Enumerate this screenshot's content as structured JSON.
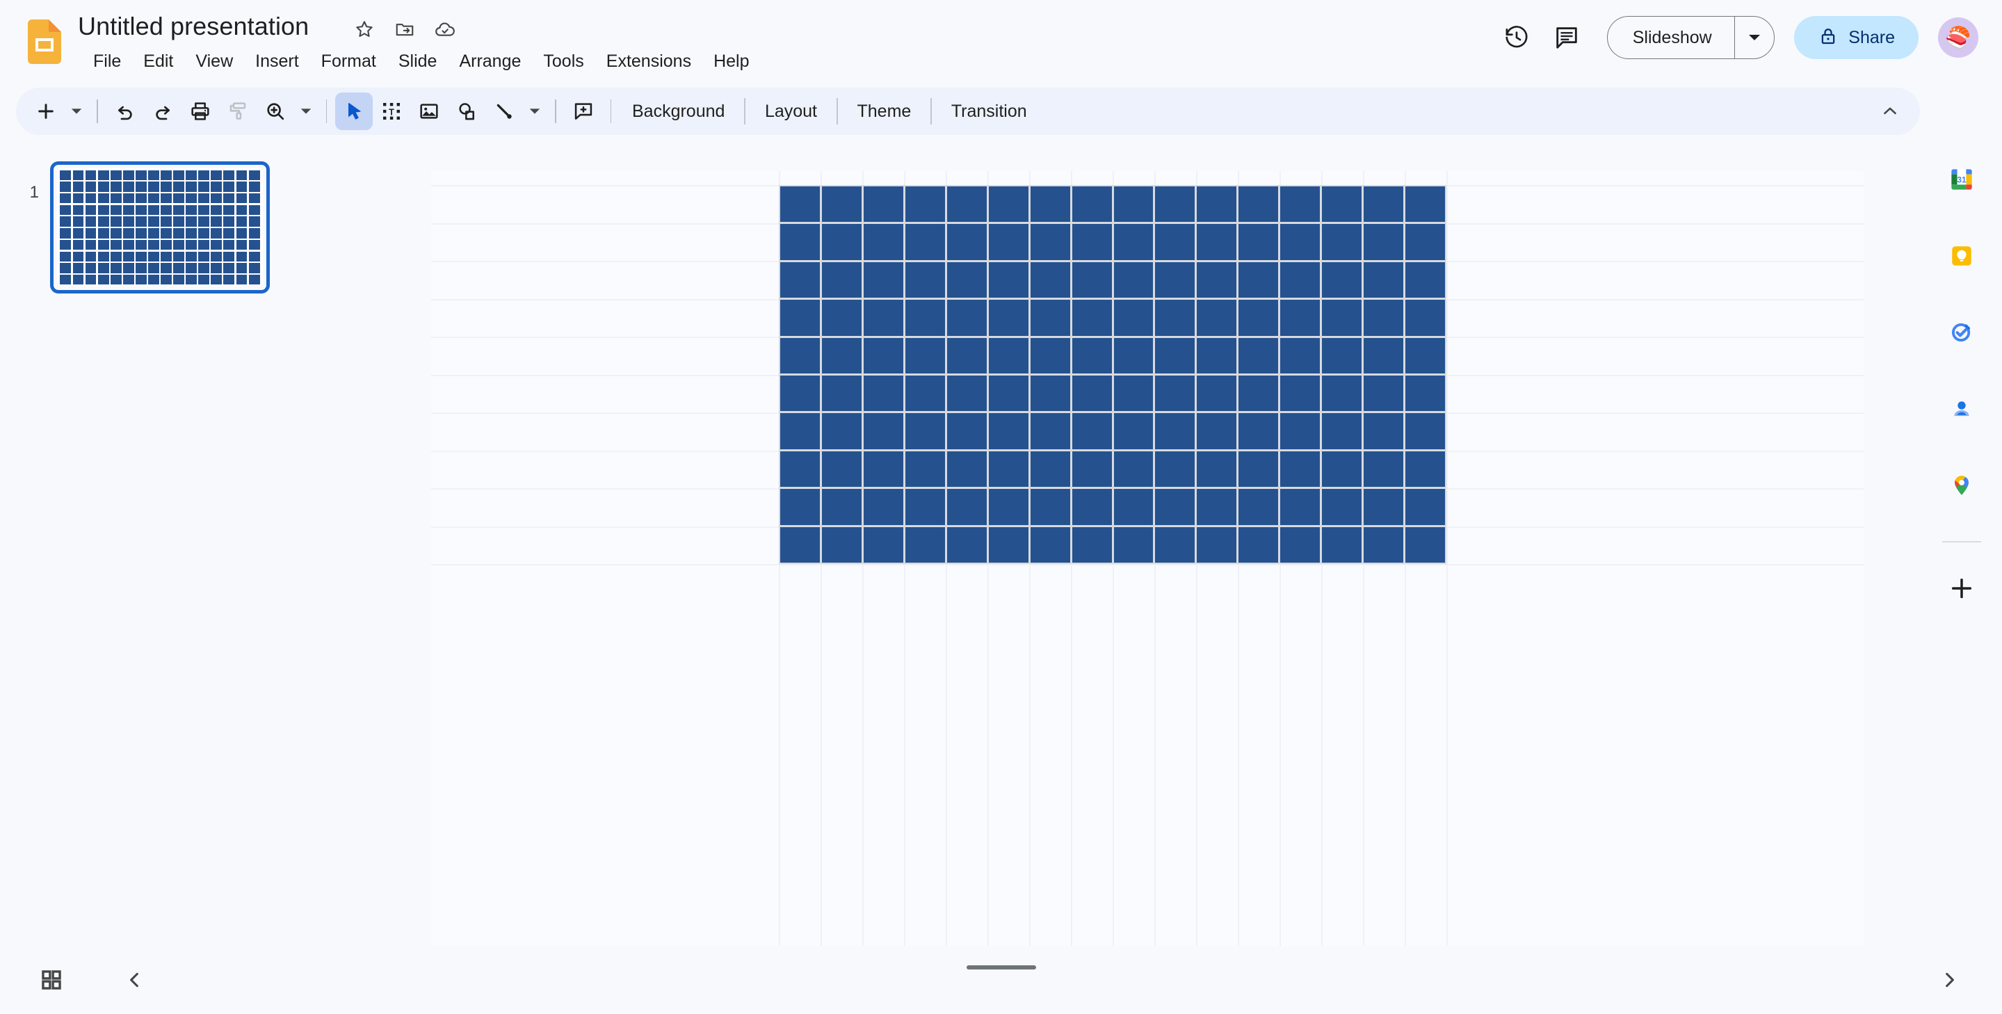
{
  "app": {
    "name": "Google Slides",
    "logo_icon": "slides-logo-icon"
  },
  "header": {
    "doc_title": "Untitled presentation",
    "title_actions": [
      {
        "name": "star-icon",
        "label": "Star"
      },
      {
        "name": "move-to-folder-icon",
        "label": "Move"
      },
      {
        "name": "cloud-saved-icon",
        "label": "Saved to Drive"
      }
    ],
    "menus": [
      "File",
      "Edit",
      "View",
      "Insert",
      "Format",
      "Slide",
      "Arrange",
      "Tools",
      "Extensions",
      "Help"
    ],
    "right_actions": {
      "history_icon": "version-history-icon",
      "comment_icon": "open-comment-history-icon",
      "slideshow_label": "Slideshow",
      "slideshow_caret_icon": "chevron-down-icon",
      "share_label": "Share",
      "share_lock_icon": "lock-icon",
      "avatar_emoji": "🍣"
    }
  },
  "toolbar": {
    "groups": [
      {
        "name": "new-slide",
        "icon": "plus-icon",
        "caret": true
      },
      {
        "name": "undo",
        "icon": "undo-icon"
      },
      {
        "name": "redo",
        "icon": "redo-icon"
      },
      {
        "name": "print",
        "icon": "print-icon"
      },
      {
        "name": "paint-format",
        "icon": "paint-roller-icon",
        "disabled": true
      },
      {
        "name": "zoom",
        "icon": "zoom-in-icon",
        "caret": true
      },
      {
        "name": "select",
        "icon": "cursor-arrow-icon",
        "active": true
      },
      {
        "name": "text-box",
        "icon": "text-box-icon"
      },
      {
        "name": "insert-image",
        "icon": "image-icon"
      },
      {
        "name": "shape",
        "icon": "shape-icon"
      },
      {
        "name": "line",
        "icon": "line-icon",
        "caret": true
      },
      {
        "name": "add-comment",
        "icon": "add-comment-icon"
      }
    ],
    "text_buttons": [
      "Background",
      "Layout",
      "Theme",
      "Transition"
    ],
    "collapse_icon": "chevron-up-icon"
  },
  "filmstrip": {
    "slides": [
      {
        "number": "1",
        "selected": true
      }
    ]
  },
  "slide_content": {
    "grid_object": {
      "columns": 16,
      "rows": 10,
      "cell_color": "#25518f",
      "gap_color": "#ffffff",
      "border_color": "#d8dade"
    },
    "guides": {
      "vertical_count": 16,
      "horizontal_count": 10,
      "color": "#eef1f7"
    }
  },
  "sidepanel": {
    "items": [
      {
        "name": "google-calendar-icon",
        "label": "Calendar",
        "badge": "31"
      },
      {
        "name": "google-keep-icon",
        "label": "Keep"
      },
      {
        "name": "google-tasks-icon",
        "label": "Tasks"
      },
      {
        "name": "google-contacts-icon",
        "label": "Contacts"
      },
      {
        "name": "google-maps-icon",
        "label": "Maps"
      }
    ],
    "add_button": {
      "name": "add-ons-plus-icon",
      "label": "Get add-ons"
    }
  },
  "bottombar": {
    "grid_view_icon": "grid-view-icon",
    "collapse_filmstrip_icon": "chevron-left-icon",
    "expand_notes_icon": "chevron-right-icon",
    "notes_handle": "speaker-notes-resize-handle"
  },
  "colors": {
    "background": "#f8f9fd",
    "toolbar_bg": "#edf2fc",
    "accent_blue": "#1b66c9",
    "share_bg": "#c2e7ff",
    "share_text": "#062e6f",
    "grid_blue": "#25518f"
  }
}
